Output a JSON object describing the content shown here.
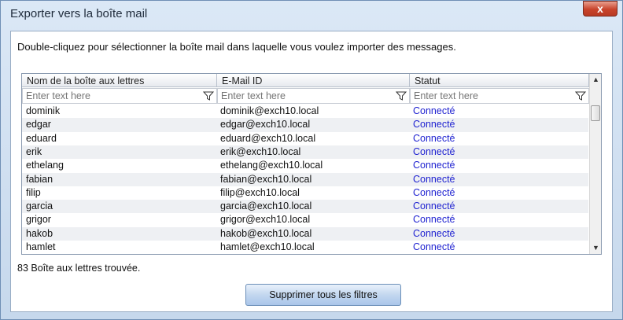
{
  "window": {
    "title": "Exporter vers la boîte mail",
    "close_label": "x"
  },
  "instruction": "Double-cliquez pour sélectionner la boîte mail dans laquelle vous voulez importer des messages.",
  "grid": {
    "columns": [
      "Nom de la boîte aux lettres",
      "E-Mail ID",
      "Statut"
    ],
    "filter_placeholder": "Enter text here",
    "rows": [
      {
        "name": "dominik",
        "email": "dominik@exch10.local",
        "status": "Connecté"
      },
      {
        "name": "edgar",
        "email": "edgar@exch10.local",
        "status": "Connecté"
      },
      {
        "name": "eduard",
        "email": "eduard@exch10.local",
        "status": "Connecté"
      },
      {
        "name": "erik",
        "email": "erik@exch10.local",
        "status": "Connecté"
      },
      {
        "name": "ethelang",
        "email": "ethelang@exch10.local",
        "status": "Connecté"
      },
      {
        "name": "fabian",
        "email": "fabian@exch10.local",
        "status": "Connecté"
      },
      {
        "name": "filip",
        "email": "filip@exch10.local",
        "status": "Connecté"
      },
      {
        "name": "garcia",
        "email": "garcia@exch10.local",
        "status": "Connecté"
      },
      {
        "name": "grigor",
        "email": "grigor@exch10.local",
        "status": "Connecté"
      },
      {
        "name": "hakob",
        "email": "hakob@exch10.local",
        "status": "Connecté"
      },
      {
        "name": "hamlet",
        "email": "hamlet@exch10.local",
        "status": "Connecté"
      }
    ]
  },
  "found_text": "83 Boîte aux lettres trouvée.",
  "clear_filters_label": "Supprimer tous les filtres",
  "colors": {
    "status": "#1c1fd0",
    "window_bg": "#c9dbee"
  }
}
